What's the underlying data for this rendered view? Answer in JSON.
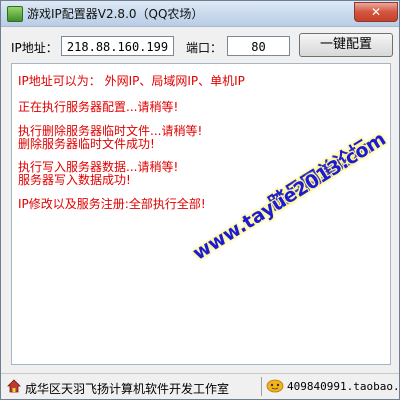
{
  "window": {
    "title": "游戏IP配置器V2.8.0（QQ农场）",
    "close_label": "✕"
  },
  "form": {
    "ip_label": "IP地址：",
    "ip_value": "218.88.160.199",
    "port_label": "端口：",
    "port_value": "80",
    "config_button": "一键配置"
  },
  "log": {
    "lines": [
      "IP地址可以为： 外网IP、局域网IP、单机IP",
      "正在执行服务器配置...请稍等!",
      "执行删除服务器临时文件...请稍等!",
      "删除服务器临时文件成功!",
      "执行写入服务器数据...请稍等!",
      "服务器写入数据成功!",
      "IP修改以及服务注册:全部执行全部!"
    ]
  },
  "watermark": {
    "site_name": "踏月网单论坛",
    "url": "www.tayue2013.com"
  },
  "status": {
    "left_text": "成华区天羽飞扬计算机软件开发工作室",
    "right_text": "409840991.taobao.com",
    "left_icon": "home-icon",
    "right_icon": "wangwang-icon"
  },
  "colors": {
    "log_text": "#e00000",
    "watermark_text": "#1b1bd6",
    "watermark_glow": "#fff7a0"
  }
}
